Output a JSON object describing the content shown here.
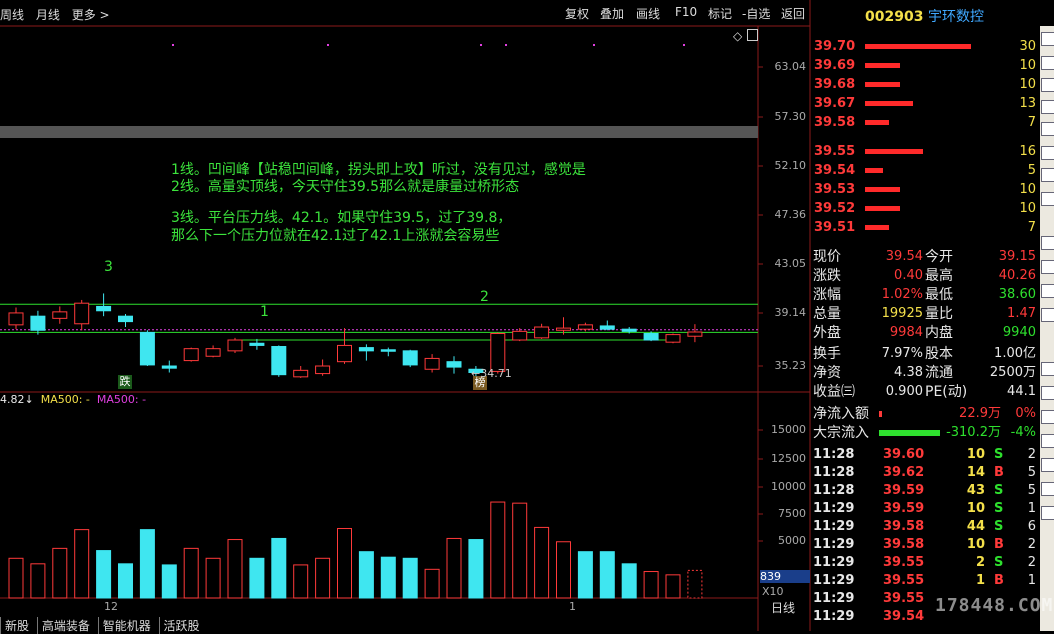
{
  "toolbar": {
    "left_items": [
      "周线",
      "月线",
      "更多 >"
    ],
    "right_items": [
      "复权",
      "叠加",
      "画线",
      "F10",
      "标记",
      "-自选",
      "返回"
    ]
  },
  "stock": {
    "code": "002903",
    "name": "宇环数控"
  },
  "order_book": {
    "asks": [
      {
        "price": "39.70",
        "vol": "30",
        "frac": 1.0
      },
      {
        "price": "39.69",
        "vol": "10",
        "frac": 0.33
      },
      {
        "price": "39.68",
        "vol": "10",
        "frac": 0.33
      },
      {
        "price": "39.67",
        "vol": "13",
        "frac": 0.45
      },
      {
        "price": "39.58",
        "vol": "7",
        "frac": 0.23
      }
    ],
    "bids": [
      {
        "price": "39.55",
        "vol": "16",
        "frac": 0.55
      },
      {
        "price": "39.54",
        "vol": "5",
        "frac": 0.17
      },
      {
        "price": "39.53",
        "vol": "10",
        "frac": 0.33
      },
      {
        "price": "39.52",
        "vol": "10",
        "frac": 0.33
      },
      {
        "price": "39.51",
        "vol": "7",
        "frac": 0.23
      }
    ]
  },
  "quote": [
    {
      "l1": "现价",
      "v1": "39.54",
      "l2": "今开",
      "v2": "39.15"
    },
    {
      "l1": "涨跌",
      "v1": "0.40",
      "l2": "最高",
      "v2": "40.26"
    },
    {
      "l1": "涨幅",
      "v1": "1.02%",
      "l2": "最低",
      "v2": "38.60"
    },
    {
      "l1": "总量",
      "v1": "19925",
      "l2": "量比",
      "v2": "1.47"
    },
    {
      "l1": "外盘",
      "v1": "9984",
      "l2": "内盘",
      "v2": "9940"
    }
  ],
  "quote2": [
    {
      "l1": "换手",
      "v1": "7.97%",
      "l2": "股本",
      "v2": "1.00亿"
    },
    {
      "l1": "净资",
      "v1": "4.38",
      "l2": "流通",
      "v2": "2500万"
    },
    {
      "l1": "收益㈢",
      "v1": "0.900",
      "l2": "PE(动)",
      "v2": "44.1"
    }
  ],
  "flows": [
    {
      "label": "净流入额",
      "value": "22.9万",
      "pct": "0%",
      "bar": 0.03,
      "color": "#ff3a3a"
    },
    {
      "label": "大宗流入",
      "value": "-310.2万",
      "pct": "-4%",
      "bar": 0.55,
      "color": "#2ee02e"
    }
  ],
  "ticks": [
    {
      "time": "11:28",
      "price": "39.60",
      "vol": "10",
      "side": "S",
      "n": "2"
    },
    {
      "time": "11:28",
      "price": "39.62",
      "vol": "14",
      "side": "B",
      "n": "5"
    },
    {
      "time": "11:28",
      "price": "39.59",
      "vol": "43",
      "side": "S",
      "n": "5"
    },
    {
      "time": "11:29",
      "price": "39.59",
      "vol": "10",
      "side": "S",
      "n": "1"
    },
    {
      "time": "11:29",
      "price": "39.58",
      "vol": "44",
      "side": "S",
      "n": "6"
    },
    {
      "time": "11:29",
      "price": "39.58",
      "vol": "10",
      "side": "B",
      "n": "2"
    },
    {
      "time": "11:29",
      "price": "39.55",
      "vol": "2",
      "side": "S",
      "n": "2"
    },
    {
      "time": "11:29",
      "price": "39.55",
      "vol": "1",
      "side": "B",
      "n": "1"
    },
    {
      "time": "11:29",
      "price": "39.55",
      "vol": "",
      "side": "",
      "n": ""
    },
    {
      "time": "11:29",
      "price": "39.54",
      "vol": "",
      "side": "",
      "n": ""
    }
  ],
  "price_axis": [
    "63.04",
    "57.30",
    "52.10",
    "47.36",
    "43.05",
    "39.14",
    "35.23"
  ],
  "volume_axis": [
    "15000",
    "12500",
    "10000",
    "7500",
    "5000"
  ],
  "volume_multiplier": "X10",
  "volume_last": "839",
  "x_labels": [
    "12",
    "1"
  ],
  "period": "日线",
  "indicator": {
    "prefix": "4.82↓",
    "ma500_a": "MA500: -",
    "ma500_b": "MA500: -"
  },
  "notes": [
    "1线。凹间峰【站稳凹间峰，拐头即上攻】听过，没有见过，感觉是",
    "2线。高量实顶线，今天守住39.5那么就是康量过桥形态",
    "3线。平台压力线。42.1。如果守住39.5，过了39.8，",
    "那么下一个压力位就在42.1过了42.1上涨就会容易些"
  ],
  "line_labels": [
    "1",
    "2",
    "3"
  ],
  "markers": {
    "die": "跌",
    "bang": "榜",
    "low": "34.71"
  },
  "tabs": [
    "新股",
    "高端装备",
    "智能机器",
    "活跃股"
  ],
  "watermark": "178448.COM",
  "colors": {
    "up": "#ff3a3a",
    "down": "#3fe6f0",
    "line": "#2ee02e",
    "ma": "#e040e0"
  },
  "chart_data": {
    "type": "candlestick",
    "candles": [
      {
        "o": 40.2,
        "c": 41.3,
        "h": 41.8,
        "l": 39.8
      },
      {
        "o": 41.0,
        "c": 39.7,
        "h": 41.5,
        "l": 39.3
      },
      {
        "o": 40.8,
        "c": 41.4,
        "h": 41.9,
        "l": 40.3
      },
      {
        "o": 40.3,
        "c": 42.2,
        "h": 42.5,
        "l": 39.7
      },
      {
        "o": 41.9,
        "c": 41.5,
        "h": 43.1,
        "l": 41.0
      },
      {
        "o": 41.0,
        "c": 40.5,
        "h": 41.2,
        "l": 40.0
      },
      {
        "o": 39.5,
        "c": 36.5,
        "h": 39.7,
        "l": 36.4
      },
      {
        "o": 36.4,
        "c": 36.2,
        "h": 36.9,
        "l": 35.8
      },
      {
        "o": 36.9,
        "c": 38.0,
        "h": 38.1,
        "l": 36.8
      },
      {
        "o": 37.3,
        "c": 38.0,
        "h": 38.3,
        "l": 37.2
      },
      {
        "o": 37.8,
        "c": 38.8,
        "h": 39.0,
        "l": 37.6
      },
      {
        "o": 38.5,
        "c": 38.3,
        "h": 38.9,
        "l": 37.9
      },
      {
        "o": 38.2,
        "c": 35.6,
        "h": 38.3,
        "l": 35.4
      },
      {
        "o": 35.4,
        "c": 36.0,
        "h": 36.4,
        "l": 35.3
      },
      {
        "o": 35.7,
        "c": 36.4,
        "h": 37.0,
        "l": 35.5
      },
      {
        "o": 36.8,
        "c": 38.3,
        "h": 39.9,
        "l": 36.6
      },
      {
        "o": 38.1,
        "c": 37.8,
        "h": 38.4,
        "l": 36.9
      },
      {
        "o": 37.9,
        "c": 37.8,
        "h": 38.1,
        "l": 37.3
      },
      {
        "o": 37.8,
        "c": 36.5,
        "h": 37.9,
        "l": 36.3
      },
      {
        "o": 36.1,
        "c": 37.1,
        "h": 37.5,
        "l": 35.8
      },
      {
        "o": 36.8,
        "c": 36.3,
        "h": 37.3,
        "l": 35.7
      },
      {
        "o": 36.1,
        "c": 35.8,
        "h": 36.4,
        "l": 34.71
      },
      {
        "o": 35.9,
        "c": 39.4,
        "h": 39.5,
        "l": 35.7
      },
      {
        "o": 38.8,
        "c": 39.6,
        "h": 39.9,
        "l": 38.7
      },
      {
        "o": 39.0,
        "c": 40.0,
        "h": 40.3,
        "l": 38.9
      },
      {
        "o": 39.7,
        "c": 39.9,
        "h": 40.9,
        "l": 39.3
      },
      {
        "o": 39.8,
        "c": 40.2,
        "h": 40.4,
        "l": 39.6
      },
      {
        "o": 40.1,
        "c": 39.8,
        "h": 40.6,
        "l": 39.7
      },
      {
        "o": 39.8,
        "c": 39.6,
        "h": 40.0,
        "l": 39.4
      },
      {
        "o": 39.4,
        "c": 38.8,
        "h": 39.6,
        "l": 38.7
      },
      {
        "o": 38.6,
        "c": 39.3,
        "h": 39.4,
        "l": 38.5
      },
      {
        "o": 39.15,
        "c": 39.54,
        "h": 40.26,
        "l": 38.6
      }
    ],
    "volume": [
      {
        "v": 3600,
        "up": true
      },
      {
        "v": 3100,
        "up": true
      },
      {
        "v": 4500,
        "up": true
      },
      {
        "v": 6200,
        "up": true
      },
      {
        "v": 4300,
        "up": false
      },
      {
        "v": 3100,
        "up": false
      },
      {
        "v": 6200,
        "up": false
      },
      {
        "v": 3000,
        "up": false
      },
      {
        "v": 4500,
        "up": true
      },
      {
        "v": 3600,
        "up": true
      },
      {
        "v": 5300,
        "up": true
      },
      {
        "v": 3600,
        "up": false
      },
      {
        "v": 5400,
        "up": false
      },
      {
        "v": 3000,
        "up": true
      },
      {
        "v": 3600,
        "up": true
      },
      {
        "v": 6300,
        "up": true
      },
      {
        "v": 4200,
        "up": false
      },
      {
        "v": 3700,
        "up": false
      },
      {
        "v": 3600,
        "up": false
      },
      {
        "v": 2600,
        "up": true
      },
      {
        "v": 5400,
        "up": true
      },
      {
        "v": 5300,
        "up": false
      },
      {
        "v": 8700,
        "up": true
      },
      {
        "v": 8600,
        "up": true
      },
      {
        "v": 6400,
        "up": true
      },
      {
        "v": 5100,
        "up": true
      },
      {
        "v": 4200,
        "up": false
      },
      {
        "v": 4200,
        "up": false
      },
      {
        "v": 3100,
        "up": false
      },
      {
        "v": 2400,
        "up": true
      },
      {
        "v": 2100,
        "up": true
      },
      {
        "v": 2500,
        "up": true
      }
    ],
    "levels": {
      "line1": 38.8,
      "line2": 39.5,
      "line3": 42.1
    },
    "price_range": [
      34.0,
      66.5
    ],
    "volume_range": [
      0,
      17500
    ]
  }
}
